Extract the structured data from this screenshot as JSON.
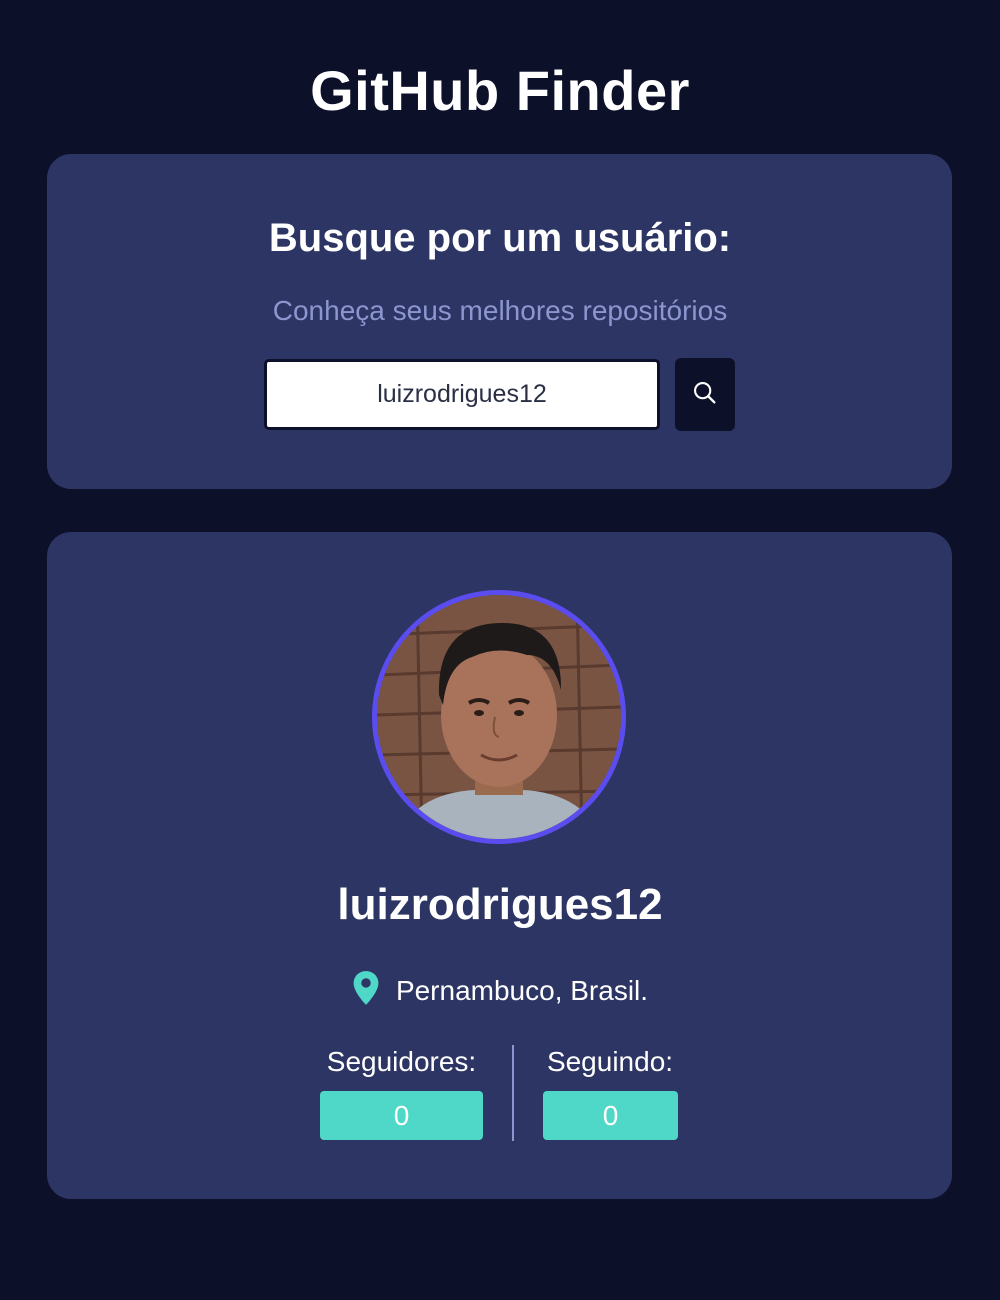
{
  "app": {
    "title": "GitHub Finder"
  },
  "search": {
    "heading": "Busque por um usuário:",
    "subtitle": "Conheça seus melhores repositórios",
    "input_value": "luizrodrigues12",
    "button_icon": "search-icon"
  },
  "profile": {
    "avatar_icon": "user-avatar-photo",
    "username": "luizrodrigues12",
    "location_icon": "map-pin-icon",
    "location": "Pernambuco, Brasil.",
    "followers_label": "Seguidores:",
    "followers_count": "0",
    "following_label": "Seguindo:",
    "following_count": "0"
  },
  "colors": {
    "background": "#0d1029",
    "card": "#2c3563",
    "accent_teal": "#4fd8c7",
    "avatar_border": "#5b4cf0",
    "subtitle": "#8d96cf"
  }
}
